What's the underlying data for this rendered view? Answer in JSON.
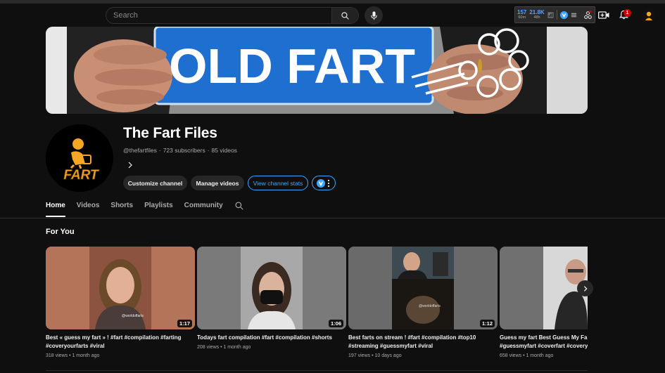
{
  "header": {
    "search": {
      "placeholder": "Search"
    },
    "extension": {
      "stat1": {
        "value": "157",
        "sub": "60m"
      },
      "stat2": {
        "value": "21.8K",
        "sub": "48h"
      }
    },
    "notification_count": "1"
  },
  "banner": {
    "text": "OLD FART"
  },
  "channel": {
    "name": "The Fart Files",
    "handle": "@thefartfiles",
    "subscribers": "723 subscribers",
    "videos": "85 videos",
    "avatar_text": "FART",
    "buttons": {
      "customize": "Customize channel",
      "manage": "Manage videos",
      "stats": "View channel stats"
    }
  },
  "tabs": [
    "Home",
    "Videos",
    "Shorts",
    "Playlists",
    "Community"
  ],
  "section_title": "For You",
  "videos": [
    {
      "title": "Best « guess my fart » ! #fart #compilation #farting\n#coveryourfarts #viral",
      "meta": "318 views • 1 month ago",
      "duration": "1:17",
      "watermark": "@worldoffarts"
    },
    {
      "title": "Todays fart compilation #fart #compilation #shorts",
      "meta": "208 views • 1 month ago",
      "duration": "1:06"
    },
    {
      "title": "Best farts on stream ! #fart #compilation #top10\n#streaming #guessmyfart #viral",
      "meta": "197 views • 10 days ago",
      "duration": "1:12",
      "watermark": "@worldoffarts"
    },
    {
      "title": "Guess my fart Best Guess My Fart\n#guessmyfart #coverfart #covery",
      "meta": "658 views • 1 month ago",
      "duration": ""
    }
  ],
  "colors": {
    "accent": "#3ea6ff",
    "background": "#0f0f0f",
    "banner_sign": "#1e6fd0",
    "badge": "#cc0000"
  }
}
